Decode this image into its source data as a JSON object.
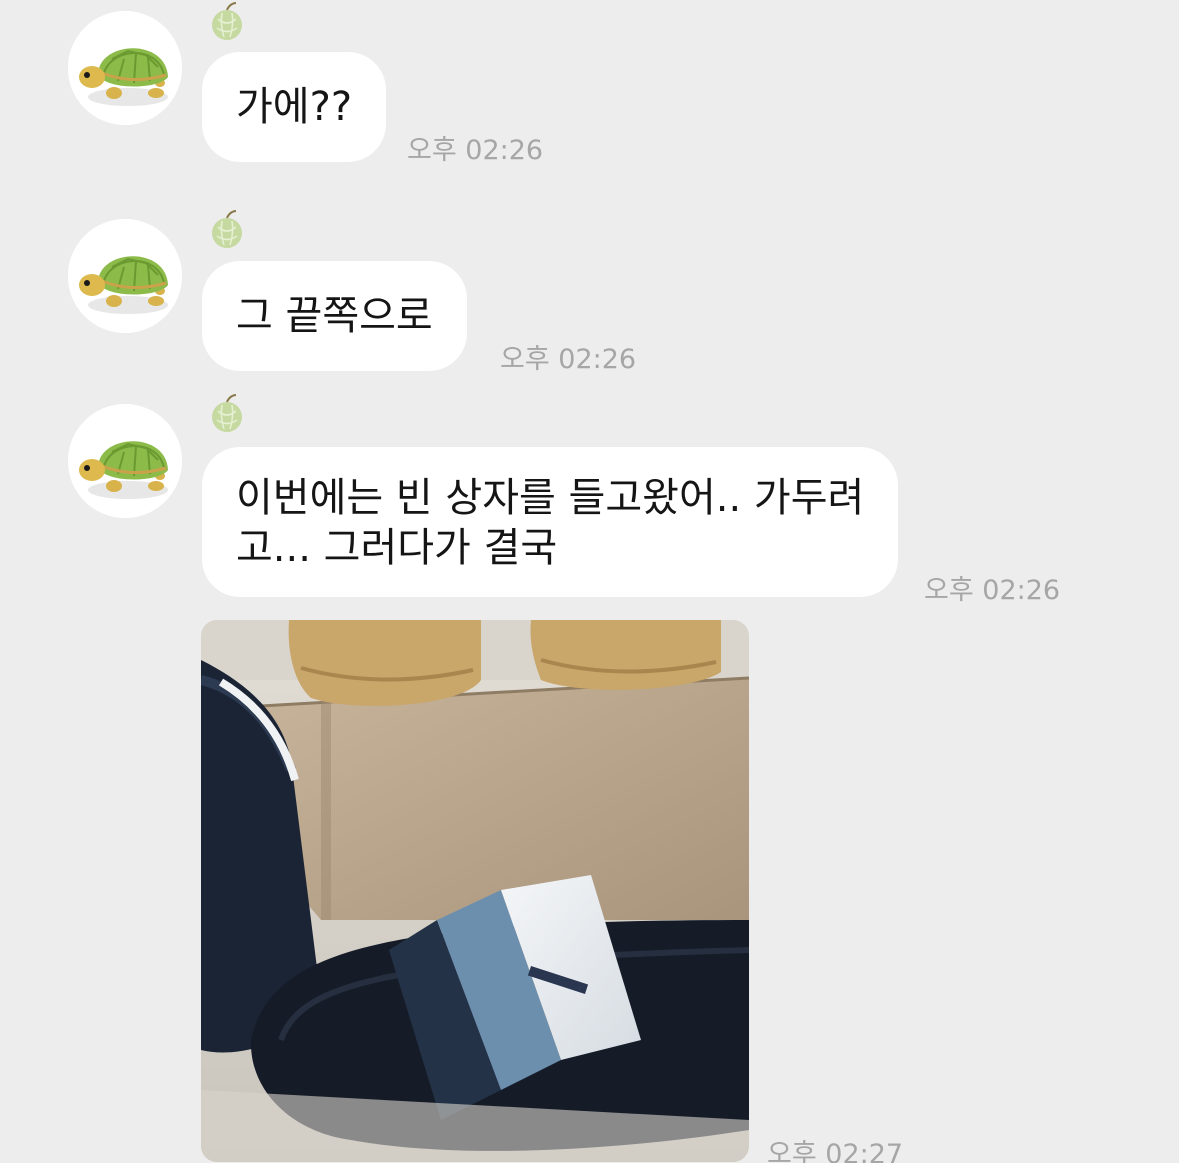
{
  "chat": {
    "messages": [
      {
        "text": "가에??",
        "time": "오후 02:26"
      },
      {
        "text": "그 끝쪽으로",
        "time": "오후 02:26"
      },
      {
        "lines": [
          "이번에는 빈 상자를 들고왔어.. 가두려",
          "고... 그러다가 결국"
        ],
        "time": "오후 02:26"
      },
      {
        "image_subject": "sandals-on-box",
        "time": "오후 02:27"
      }
    ]
  },
  "colors": {
    "background": "#ededed",
    "bubble": "#ffffff",
    "text": "#151515",
    "timestamp": "#a6a6a6"
  },
  "icons": {
    "avatar": "turtle-avatar",
    "badge": "melon-badge-icon"
  }
}
